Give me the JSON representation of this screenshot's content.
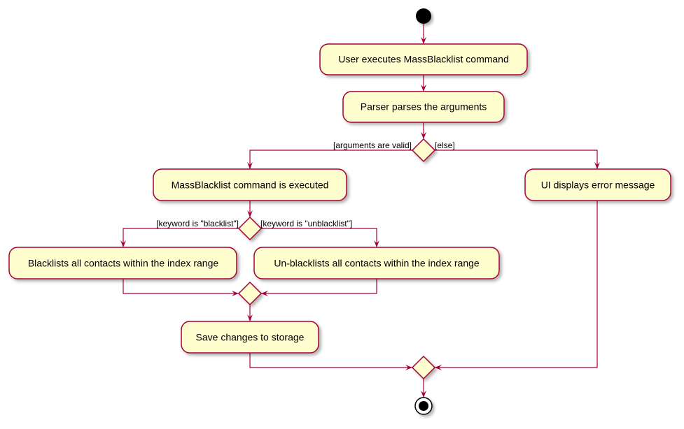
{
  "colors": {
    "line": "#A80036",
    "fill": "#FEFECE"
  },
  "activities": {
    "user_executes": "User executes MassBlacklist command",
    "parser_parses": "Parser parses the arguments",
    "command_executed": "MassBlacklist command is executed",
    "ui_error": "UI displays error message",
    "blacklist_all": "Blacklists all contacts within the index range",
    "unblacklist_all": "Un-blacklists all contacts within the index range",
    "save_changes": "Save changes to storage"
  },
  "guards": {
    "args_valid": "[arguments are valid]",
    "else": "[else]",
    "keyword_blacklist": "[keyword is \"blacklist\"]",
    "keyword_unblacklist": "[keyword is \"unblacklist\"]"
  }
}
